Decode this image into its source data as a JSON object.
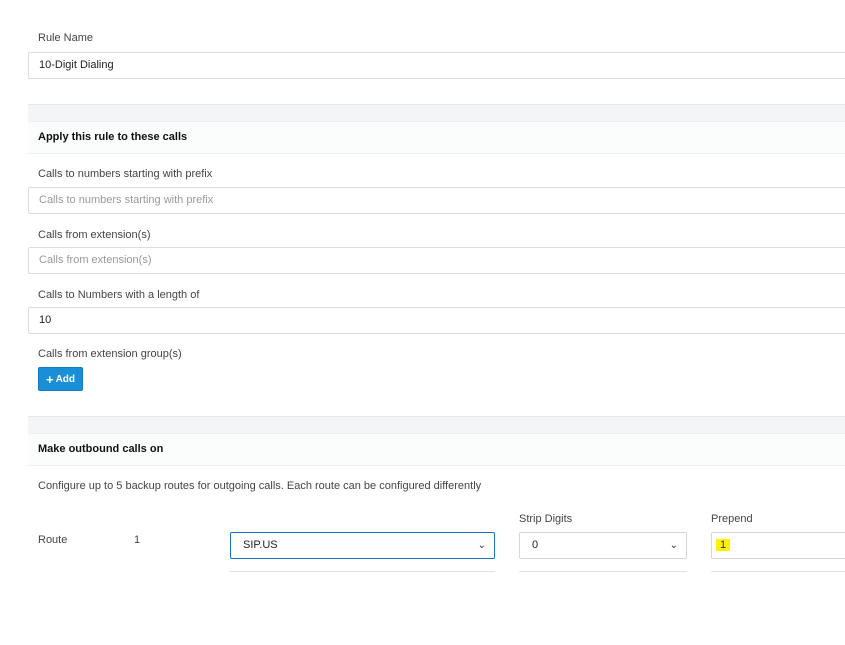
{
  "rule_name": {
    "label": "Rule Name",
    "value": "10-Digit Dialing"
  },
  "apply_section": {
    "title": "Apply this rule to these calls",
    "prefix_label": "Calls to numbers starting with prefix",
    "prefix_placeholder": "Calls to numbers starting with prefix",
    "from_ext_label": "Calls from extension(s)",
    "from_ext_placeholder": "Calls from extension(s)",
    "length_label": "Calls to Numbers with a length of",
    "length_value": "10",
    "group_label": "Calls from extension group(s)",
    "add_button_label": "Add",
    "add_icon": "plus-icon"
  },
  "outbound_section": {
    "title": "Make outbound calls on",
    "description": "Configure up to 5 backup routes for outgoing calls. Each route can be configured differently",
    "route_label": "Route",
    "route_number": "1",
    "route_value": "SIP.US",
    "strip_digits_label": "Strip Digits",
    "strip_digits_value": "0",
    "prepend_label": "Prepend",
    "prepend_value": "1",
    "chevron_icon": "chevron-down-icon",
    "highlight_color": "#fff200",
    "accent_color": "#1a8fd8"
  }
}
